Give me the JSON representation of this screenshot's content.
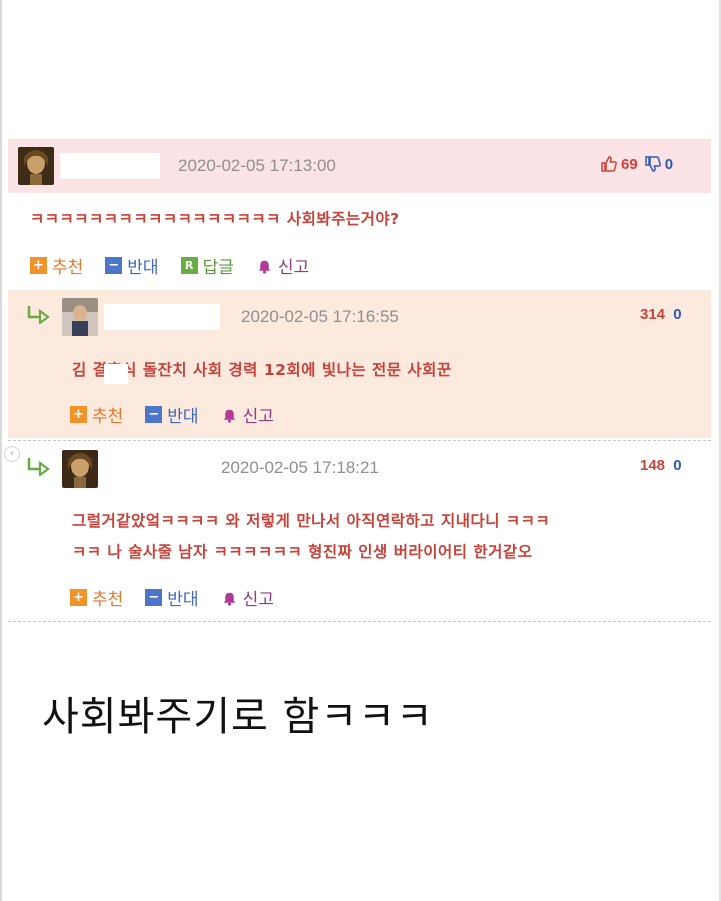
{
  "comments": [
    {
      "timestamp": "2020-02-05 17:13:00",
      "up_count": "69",
      "down_count": "0",
      "text": "ㅋㅋㅋㅋㅋㅋㅋㅋㅋㅋㅋㅋㅋㅋㅋㅋㅋ 사회봐주는거야?",
      "actions": {
        "recommend": "추천",
        "oppose": "반대",
        "reply": "답글",
        "report": "신고"
      }
    },
    {
      "timestamp": "2020-02-05 17:16:55",
      "up_count": "314",
      "down_count": "0",
      "text": "김 결혼식 돌잔치 사회 경력 12회에 빛나는 전문 사회꾼",
      "actions": {
        "recommend": "추천",
        "oppose": "반대",
        "report": "신고"
      }
    },
    {
      "timestamp": "2020-02-05 17:18:21",
      "up_count": "148",
      "down_count": "0",
      "text_line1": "그럴거같았엌ㅋㅋㅋㅋ 와 저렇게 만나서 아직연락하고 지내다니 ㅋㅋㅋ",
      "text_line2": "ㅋㅋ 나 술사줄 남자 ㅋㅋㅋㅋㅋㅋ 형진짜 인생 버라이어티 한거같오",
      "actions": {
        "recommend": "추천",
        "oppose": "반대",
        "report": "신고"
      }
    }
  ],
  "caption": "사회봐주기로 함ㅋㅋㅋ",
  "colors": {
    "header_pink": "#fbe3e6",
    "reply_peach": "#fdeadf",
    "text_red": "#c5433a",
    "vote_blue": "#2d59b5"
  },
  "icons": [
    "avatar-icon",
    "thumbs-up-icon",
    "thumbs-down-icon",
    "reply-arrow-icon",
    "plus-icon",
    "minus-icon",
    "reply-r-icon",
    "report-bell-icon"
  ]
}
